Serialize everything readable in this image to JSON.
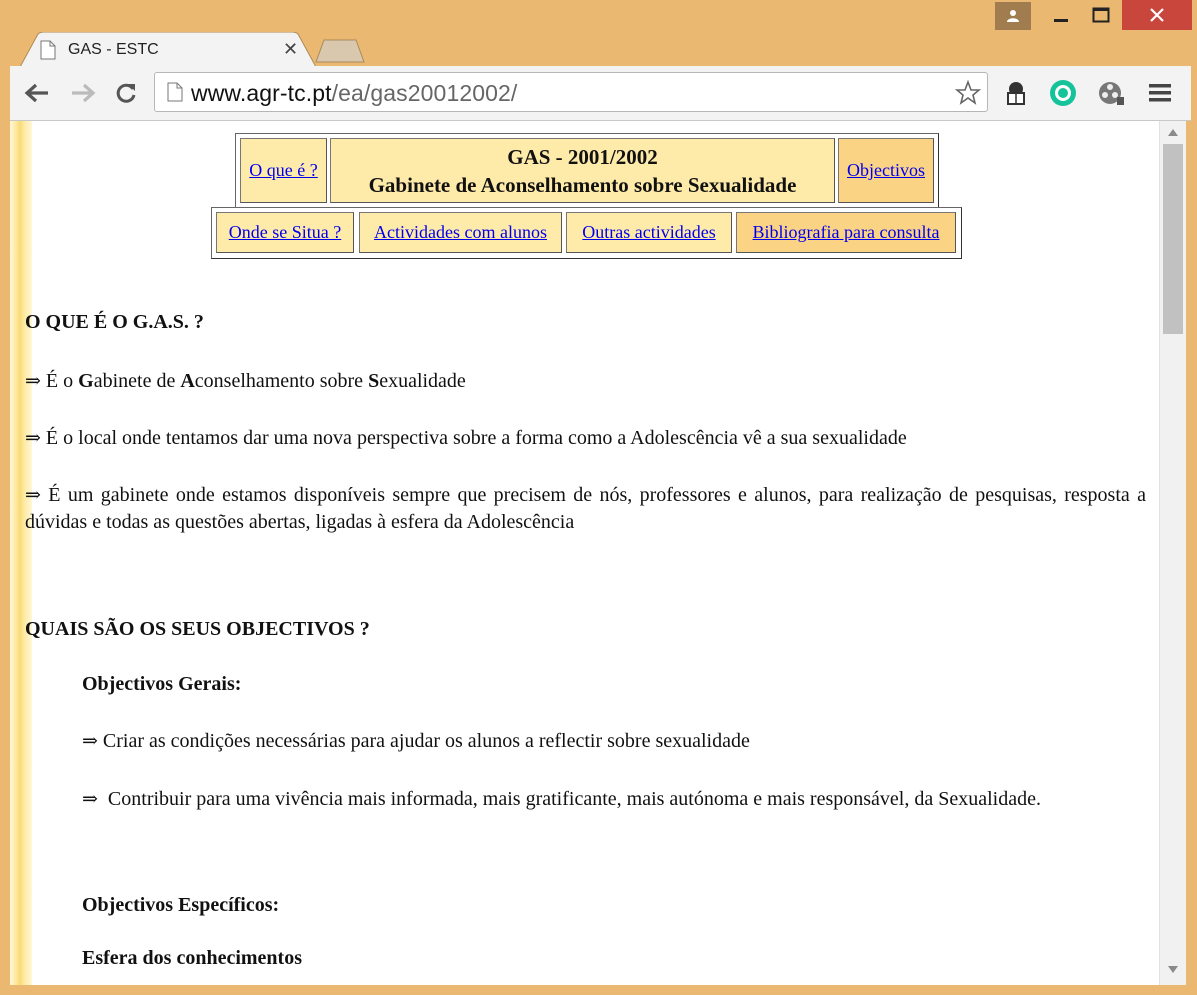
{
  "browser": {
    "tab_title": "GAS - ESTC",
    "url_host": "www.agr-tc.pt",
    "url_path": "/ea/gas20012002/"
  },
  "nav": {
    "o_que_e": "O que é ?",
    "title_line1": "GAS - 2001/2002",
    "title_line2": "Gabinete de Aconselhamento sobre Sexualidade",
    "objectivos": "Objectivos",
    "onde_se_situa": "Onde se Situa ?",
    "actividades_alunos": "Actividades com alunos",
    "outras_actividades": "Outras actividades",
    "bibliografia": "Bibliografia para consulta"
  },
  "section1": {
    "heading": "O QUE É O G.A.S. ?",
    "bullet1_pre": "É o ",
    "bullet1_g": "G",
    "bullet1_g_rest": "abinete de ",
    "bullet1_a": "A",
    "bullet1_a_rest": "conselhamento sobre ",
    "bullet1_s": "S",
    "bullet1_s_rest": "exualidade",
    "bullet2": "É o local onde tentamos dar uma nova perspectiva sobre a forma como a Adolescência vê a sua sexualidade",
    "bullet3": "É um gabinete onde estamos disponíveis sempre que precisem de nós, professores e alunos, para realização de pesquisas, resposta a dúvidas e todas as questões abertas, ligadas à esfera da Adolescência"
  },
  "section2": {
    "heading": "QUAIS SÃO OS SEUS OBJECTIVOS ?",
    "gerais_heading": "Objectivos Gerais:",
    "gerais_1": "Criar as condições necessárias para ajudar os alunos a reflectir sobre sexualidade",
    "gerais_2": "Contribuir para uma vivência mais informada, mais gratificante, mais autónoma e mais responsável, da Sexualidade.",
    "especificos_heading": "Objectivos Específicos:",
    "esfera_heading": "Esfera dos conhecimentos"
  },
  "symbols": {
    "arrow": "⇒"
  },
  "colors": {
    "frame": "#eab871",
    "cell_pale": "#feeaa9",
    "cell_gold": "#fbd384",
    "link": "#0000ee"
  }
}
